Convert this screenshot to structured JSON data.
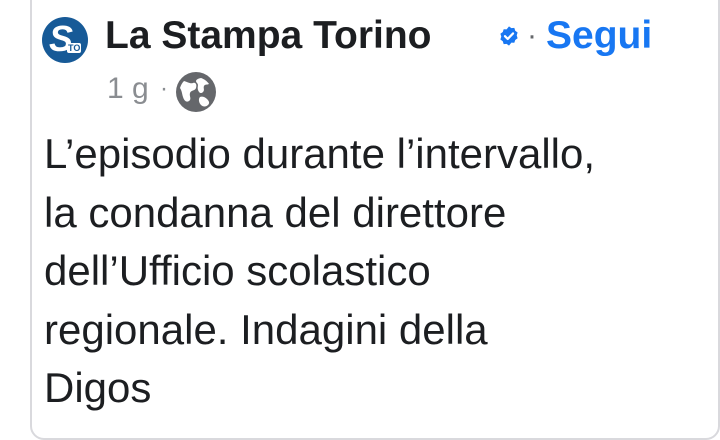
{
  "post": {
    "page_name": "La Stampa Torino",
    "follow_label": "Segui",
    "time": "1 g",
    "text": "L’episodio durante l’intervallo,\nla condanna del direttore\ndell’Ufficio scolastico\nregionale. Indagini della\nDigos",
    "avatar": {
      "letter": "S",
      "sub": "TO",
      "color": "#175a97"
    },
    "icons": {
      "verified": "verified-badge-icon",
      "audience": "globe-icon"
    }
  },
  "colors": {
    "name_text": "#1c1e21",
    "follow": "#1877f2",
    "meta": "#8a8d91"
  }
}
